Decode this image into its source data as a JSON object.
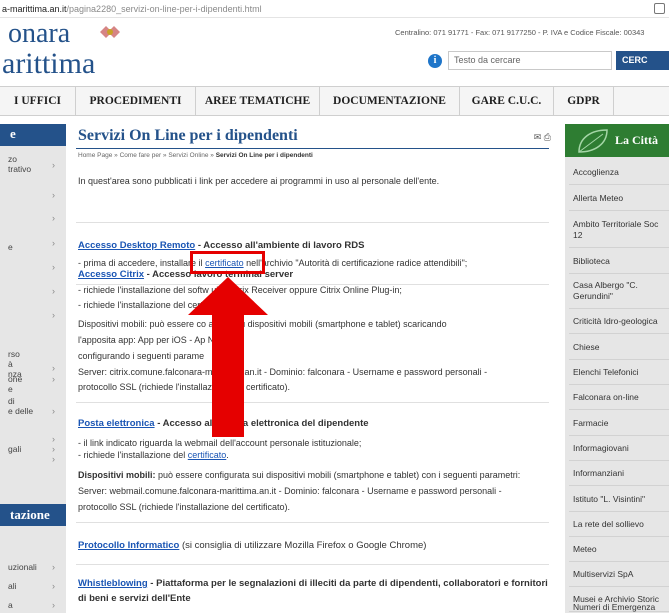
{
  "browser": {
    "url_host": "a-marittima.an.it",
    "url_path": "/pagina2280_servizi-on-line-per-i-dipendenti.html"
  },
  "header": {
    "logo_line1": "onara",
    "logo_line2": "arittima",
    "contacts": "Centralino: 071 91771 - Fax: 071 9177250 - P. IVA e Codice Fiscale: 00343",
    "search_placeholder": "Testo da cercare",
    "search_button": "CERC",
    "info_glyph": "i"
  },
  "nav": {
    "items": [
      "I UFFICI",
      "PROCEDIMENTI",
      "AREE TEMATICHE",
      "DOCUMENTAZIONE",
      "GARE C.U.C.",
      "GDPR"
    ]
  },
  "left_sidebar": {
    "heading": "e",
    "items": [
      "zo\ntrativo",
      "",
      "",
      "e",
      "",
      "",
      "",
      "rso\nà\nnza",
      "one\ne",
      "di\ne delle",
      "",
      "",
      "gali"
    ],
    "section_heading": "tazione",
    "section_items": [
      "uzionali",
      "ali",
      "a"
    ]
  },
  "main": {
    "title": "Servizi On Line per i dipendenti",
    "breadcrumb": {
      "home": "Home Page",
      "sep": " » ",
      "b2": "Come fare per",
      "b3": "Servizi Online",
      "current": "Servizi On Line per i dipendenti"
    },
    "intro": "In quest'area sono pubblicati i link per accedere ai programmi in uso al personale dell'ente.",
    "sections": {
      "desktop": {
        "link": "Accesso Desktop Remoto",
        "desc": " - Accesso all'ambiente di lavoro RDS",
        "line1_pre": "- prima di accedere, installare il ",
        "line1_link": "certificato",
        "line1_post": " nell'archivio \"Autorità di certificazione radice attendibili\";"
      },
      "citrix": {
        "link": "Accesso Citrix",
        "desc": " - Accesso                                    lavoro terminal server",
        "lines": [
          "- richiede l'installazione del softw                uito Citrix Receiver oppure Citrix Online Plug-in;",
          "- richiede l'installazione del certif",
          "Dispositivi mobili: può essere co                 anche su dispositivi mobili (smartphone e tablet) scaricando",
          "l'apposita app: App per iOS - Ap              NDROID",
          "configurando i seguenti parame",
          "Server: citrix.comune.falconara-marittima.an.it - Dominio: falconara - Username e password personali -",
          "protocollo SSL (richiede l'installazione del certificato)."
        ]
      },
      "posta": {
        "link": "Posta elettronica",
        "desc": " - Accesso alla posta elettronica del dipendente",
        "line1": "- il link indicato riguarda la webmail dell'account personale istituzionale;",
        "line2_pre": "- richiede l'installazione del ",
        "line2_link": "certificato",
        "line2_post": ".",
        "mobile_bold": "Dispositivi mobili:",
        "mobile_rest": " può essere configurata sui dispositivi mobili (smartphone e tablet) con i seguenti parametri:",
        "line4": "Server: webmail.comune.falconara-marittima.an.it - Dominio: falconara - Username e password personali -",
        "line5": "protocollo SSL (richiede l'installazione del certificato)."
      },
      "protocollo": {
        "link": "Protocollo Informatico",
        "desc": " (si consiglia di utilizzare Mozilla Firefox o Google Chrome)"
      },
      "whistle": {
        "link": "Whistleblowing",
        "desc": " - Piattaforma per le segnalazioni di illeciti da parte di dipendenti, collaboratori e fornitori",
        "desc2": "di beni e servizi dell'Ente"
      }
    }
  },
  "right_sidebar": {
    "heading": "La Città",
    "items": [
      "Accoglienza",
      "Allerta Meteo",
      "Ambito Territoriale Soc\n12",
      "Biblioteca",
      "Casa Albergo \"C.\nGerundini\"",
      "Criticità Idro-geologica",
      "Chiese",
      "Elenchi Telefonici",
      "Falconara on-line",
      "Farmacie",
      "Informagiovani",
      "Informanziani",
      "Istituto \"L. Visintini\"",
      "La rete del sollievo",
      "Meteo",
      "Multiservizi SpA",
      "Musei e Archivio Storic",
      "Numeri di Emergenza"
    ]
  },
  "colors": {
    "brand_blue": "#24528a",
    "link_blue": "#1a55b4",
    "city_green": "#2e7d32",
    "annotation_red": "#e50000"
  },
  "icons": {
    "print": "print-icon",
    "email": "email-icon",
    "info": "info-icon",
    "chevron": "chevron-right-icon"
  }
}
